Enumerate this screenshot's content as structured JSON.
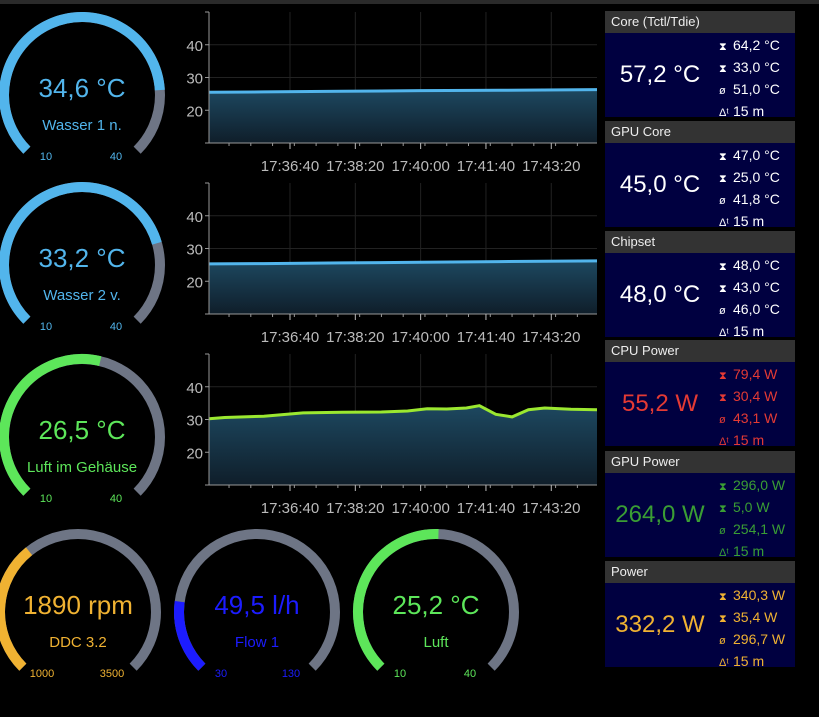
{
  "colors": {
    "blue": "#52b5ec",
    "green": "#5de65a",
    "yellow": "#f0b232",
    "flow": "#1c1cff",
    "track": "#6e7585",
    "red": "#e43a34",
    "darkgreen": "#3a9e34",
    "white": "#ffffff",
    "cardbg": "#000040"
  },
  "gauges": [
    {
      "value_text": "34,6 °C",
      "label": "Wasser 1 n.",
      "value": 34.6,
      "min": 10,
      "max": 40,
      "min_label": "10",
      "max_label": "40",
      "color": "#52b5ec"
    },
    {
      "value_text": "33,2 °C",
      "label": "Wasser 2 v.",
      "value": 33.2,
      "min": 10,
      "max": 40,
      "min_label": "10",
      "max_label": "40",
      "color": "#52b5ec"
    },
    {
      "value_text": "26,5 °C",
      "label": "Luft im Gehäuse",
      "value": 26.5,
      "min": 10,
      "max": 40,
      "min_label": "10",
      "max_label": "40",
      "color": "#5de65a"
    },
    {
      "value_text": "1890 rpm",
      "label": "DDC 3.2",
      "value": 1890,
      "min": 1000,
      "max": 3500,
      "min_label": "1000",
      "max_label": "3500",
      "color": "#f0b232"
    },
    {
      "value_text": "49,5 l/h",
      "label": "Flow 1",
      "value": 49.5,
      "min": 30,
      "max": 130,
      "min_label": "30",
      "max_label": "130",
      "color": "#1c1cff"
    },
    {
      "value_text": "25,2 °C",
      "label": "Luft",
      "value": 25.2,
      "min": 10,
      "max": 40,
      "min_label": "10",
      "max_label": "40",
      "color": "#5de65a"
    }
  ],
  "chart_data": [
    {
      "type": "area",
      "ylim": [
        10,
        50
      ],
      "yticks": [
        "20",
        "30",
        "40"
      ],
      "xticks": [
        "17:36:40",
        "17:38:20",
        "17:40:00",
        "17:41:40",
        "17:43:20"
      ],
      "color": "#52b5ec",
      "x": [
        "17:34:36",
        "17:36:00",
        "17:38:00",
        "17:40:00",
        "17:42:00",
        "17:44:30"
      ],
      "y": [
        25.5,
        25.6,
        25.8,
        26.0,
        26.1,
        26.3
      ]
    },
    {
      "type": "area",
      "ylim": [
        10,
        50
      ],
      "yticks": [
        "20",
        "30",
        "40"
      ],
      "xticks": [
        "17:36:40",
        "17:38:20",
        "17:40:00",
        "17:41:40",
        "17:43:20"
      ],
      "color": "#52b5ec",
      "x": [
        "17:34:36",
        "17:36:00",
        "17:38:00",
        "17:40:00",
        "17:42:00",
        "17:44:30"
      ],
      "y": [
        25.3,
        25.4,
        25.6,
        25.8,
        26.0,
        26.2
      ]
    },
    {
      "type": "area",
      "ylim": [
        10,
        50
      ],
      "yticks": [
        "20",
        "30",
        "40"
      ],
      "xticks": [
        "17:36:40",
        "17:38:20",
        "17:40:00",
        "17:41:40",
        "17:43:20"
      ],
      "color": "#9be830",
      "x": [
        "17:34:36",
        "17:35:00",
        "17:36:00",
        "17:37:00",
        "17:38:00",
        "17:39:00",
        "17:39:40",
        "17:40:10",
        "17:40:40",
        "17:41:10",
        "17:41:30",
        "17:41:55",
        "17:42:20",
        "17:42:45",
        "17:43:10",
        "17:43:50",
        "17:44:30"
      ],
      "y": [
        30.2,
        30.6,
        31.0,
        32.0,
        32.2,
        32.3,
        32.6,
        33.3,
        33.2,
        33.5,
        34.2,
        31.6,
        30.8,
        33.0,
        33.5,
        33.1,
        33.0
      ]
    }
  ],
  "cards": [
    {
      "title": "Core (Tctl/Tdie)",
      "value": "57,2 °C",
      "max": "64,2 °C",
      "min": "33,0 °C",
      "avg": "51,0 °C",
      "period": "15 m",
      "color": "#ffffff"
    },
    {
      "title": "GPU Core",
      "value": "45,0 °C",
      "max": "47,0 °C",
      "min": "25,0 °C",
      "avg": "41,8 °C",
      "period": "15 m",
      "color": "#ffffff"
    },
    {
      "title": "Chipset",
      "value": "48,0 °C",
      "max": "48,0 °C",
      "min": "43,0 °C",
      "avg": "46,0 °C",
      "period": "15 m",
      "color": "#ffffff"
    },
    {
      "title": "CPU Power",
      "value": "55,2 W",
      "max": "79,4 W",
      "min": "30,4 W",
      "avg": "43,1 W",
      "period": "15 m",
      "color": "#e43a34"
    },
    {
      "title": "GPU Power",
      "value": "264,0 W",
      "max": "296,0 W",
      "min": "5,0 W",
      "avg": "254,1 W",
      "period": "15 m",
      "color": "#3a9e34"
    },
    {
      "title": "Power",
      "value": "332,2 W",
      "max": "340,3 W",
      "min": "35,4 W",
      "avg": "296,7 W",
      "period": "15 m",
      "color": "#f0b232"
    }
  ],
  "icons": {
    "max": "hourglass-top-icon",
    "min": "hourglass-bottom-icon",
    "avg": "average-icon",
    "period": "delta-t-icon"
  }
}
